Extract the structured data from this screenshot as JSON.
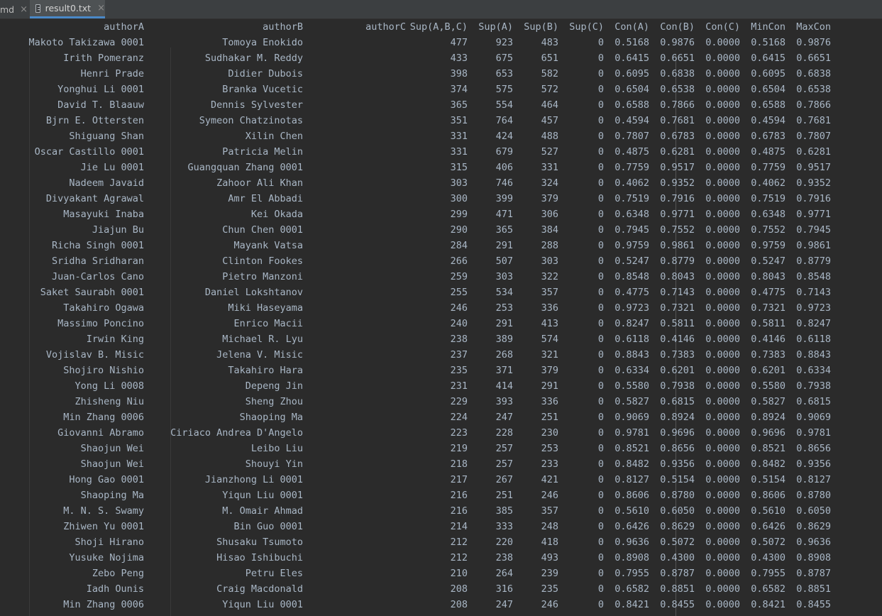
{
  "tabs": {
    "previous": "md",
    "active": "result0.txt",
    "close_glyph": "×"
  },
  "columns": [
    "authorA",
    "authorB",
    "authorC",
    "Sup(A,B,C)",
    "Sup(A)",
    "Sup(B)",
    "Sup(C)",
    "Con(A)",
    "Con(B)",
    "Con(C)",
    "MinCon",
    "MaxCon"
  ],
  "rows": [
    [
      "Makoto Takizawa 0001",
      "Tomoya Enokido",
      "",
      "477",
      "923",
      "483",
      "0",
      "0.5168",
      "0.9876",
      "0.0000",
      "0.5168",
      "0.9876"
    ],
    [
      "Irith Pomeranz",
      "Sudhakar M. Reddy",
      "",
      "433",
      "675",
      "651",
      "0",
      "0.6415",
      "0.6651",
      "0.0000",
      "0.6415",
      "0.6651"
    ],
    [
      "Henri Prade",
      "Didier Dubois",
      "",
      "398",
      "653",
      "582",
      "0",
      "0.6095",
      "0.6838",
      "0.0000",
      "0.6095",
      "0.6838"
    ],
    [
      "Yonghui Li 0001",
      "Branka Vucetic",
      "",
      "374",
      "575",
      "572",
      "0",
      "0.6504",
      "0.6538",
      "0.0000",
      "0.6504",
      "0.6538"
    ],
    [
      "David T. Blaauw",
      "Dennis Sylvester",
      "",
      "365",
      "554",
      "464",
      "0",
      "0.6588",
      "0.7866",
      "0.0000",
      "0.6588",
      "0.7866"
    ],
    [
      "Bjrn E. Ottersten",
      "Symeon Chatzinotas",
      "",
      "351",
      "764",
      "457",
      "0",
      "0.4594",
      "0.7681",
      "0.0000",
      "0.4594",
      "0.7681"
    ],
    [
      "Shiguang Shan",
      "Xilin Chen",
      "",
      "331",
      "424",
      "488",
      "0",
      "0.7807",
      "0.6783",
      "0.0000",
      "0.6783",
      "0.7807"
    ],
    [
      "Oscar Castillo 0001",
      "Patricia Melin",
      "",
      "331",
      "679",
      "527",
      "0",
      "0.4875",
      "0.6281",
      "0.0000",
      "0.4875",
      "0.6281"
    ],
    [
      "Jie Lu 0001",
      "Guangquan Zhang 0001",
      "",
      "315",
      "406",
      "331",
      "0",
      "0.7759",
      "0.9517",
      "0.0000",
      "0.7759",
      "0.9517"
    ],
    [
      "Nadeem Javaid",
      "Zahoor Ali Khan",
      "",
      "303",
      "746",
      "324",
      "0",
      "0.4062",
      "0.9352",
      "0.0000",
      "0.4062",
      "0.9352"
    ],
    [
      "Divyakant Agrawal",
      "Amr El Abbadi",
      "",
      "300",
      "399",
      "379",
      "0",
      "0.7519",
      "0.7916",
      "0.0000",
      "0.7519",
      "0.7916"
    ],
    [
      "Masayuki Inaba",
      "Kei Okada",
      "",
      "299",
      "471",
      "306",
      "0",
      "0.6348",
      "0.9771",
      "0.0000",
      "0.6348",
      "0.9771"
    ],
    [
      "Jiajun Bu",
      "Chun Chen 0001",
      "",
      "290",
      "365",
      "384",
      "0",
      "0.7945",
      "0.7552",
      "0.0000",
      "0.7552",
      "0.7945"
    ],
    [
      "Richa Singh 0001",
      "Mayank Vatsa",
      "",
      "284",
      "291",
      "288",
      "0",
      "0.9759",
      "0.9861",
      "0.0000",
      "0.9759",
      "0.9861"
    ],
    [
      "Sridha Sridharan",
      "Clinton Fookes",
      "",
      "266",
      "507",
      "303",
      "0",
      "0.5247",
      "0.8779",
      "0.0000",
      "0.5247",
      "0.8779"
    ],
    [
      "Juan-Carlos Cano",
      "Pietro Manzoni",
      "",
      "259",
      "303",
      "322",
      "0",
      "0.8548",
      "0.8043",
      "0.0000",
      "0.8043",
      "0.8548"
    ],
    [
      "Saket Saurabh 0001",
      "Daniel Lokshtanov",
      "",
      "255",
      "534",
      "357",
      "0",
      "0.4775",
      "0.7143",
      "0.0000",
      "0.4775",
      "0.7143"
    ],
    [
      "Takahiro Ogawa",
      "Miki Haseyama",
      "",
      "246",
      "253",
      "336",
      "0",
      "0.9723",
      "0.7321",
      "0.0000",
      "0.7321",
      "0.9723"
    ],
    [
      "Massimo Poncino",
      "Enrico Macii",
      "",
      "240",
      "291",
      "413",
      "0",
      "0.8247",
      "0.5811",
      "0.0000",
      "0.5811",
      "0.8247"
    ],
    [
      "Irwin King",
      "Michael R. Lyu",
      "",
      "238",
      "389",
      "574",
      "0",
      "0.6118",
      "0.4146",
      "0.0000",
      "0.4146",
      "0.6118"
    ],
    [
      "Vojislav B. Misic",
      "Jelena V. Misic",
      "",
      "237",
      "268",
      "321",
      "0",
      "0.8843",
      "0.7383",
      "0.0000",
      "0.7383",
      "0.8843"
    ],
    [
      "Shojiro Nishio",
      "Takahiro Hara",
      "",
      "235",
      "371",
      "379",
      "0",
      "0.6334",
      "0.6201",
      "0.0000",
      "0.6201",
      "0.6334"
    ],
    [
      "Yong Li 0008",
      "Depeng Jin",
      "",
      "231",
      "414",
      "291",
      "0",
      "0.5580",
      "0.7938",
      "0.0000",
      "0.5580",
      "0.7938"
    ],
    [
      "Zhisheng Niu",
      "Sheng Zhou",
      "",
      "229",
      "393",
      "336",
      "0",
      "0.5827",
      "0.6815",
      "0.0000",
      "0.5827",
      "0.6815"
    ],
    [
      "Min Zhang 0006",
      "Shaoping Ma",
      "",
      "224",
      "247",
      "251",
      "0",
      "0.9069",
      "0.8924",
      "0.0000",
      "0.8924",
      "0.9069"
    ],
    [
      "Giovanni Abramo",
      "Ciriaco Andrea D'Angelo",
      "",
      "223",
      "228",
      "230",
      "0",
      "0.9781",
      "0.9696",
      "0.0000",
      "0.9696",
      "0.9781"
    ],
    [
      "Shaojun Wei",
      "Leibo Liu",
      "",
      "219",
      "257",
      "253",
      "0",
      "0.8521",
      "0.8656",
      "0.0000",
      "0.8521",
      "0.8656"
    ],
    [
      "Shaojun Wei",
      "Shouyi Yin",
      "",
      "218",
      "257",
      "233",
      "0",
      "0.8482",
      "0.9356",
      "0.0000",
      "0.8482",
      "0.9356"
    ],
    [
      "Hong Gao 0001",
      "Jianzhong Li 0001",
      "",
      "217",
      "267",
      "421",
      "0",
      "0.8127",
      "0.5154",
      "0.0000",
      "0.5154",
      "0.8127"
    ],
    [
      "Shaoping Ma",
      "Yiqun Liu 0001",
      "",
      "216",
      "251",
      "246",
      "0",
      "0.8606",
      "0.8780",
      "0.0000",
      "0.8606",
      "0.8780"
    ],
    [
      "M. N. S. Swamy",
      "M. Omair Ahmad",
      "",
      "216",
      "385",
      "357",
      "0",
      "0.5610",
      "0.6050",
      "0.0000",
      "0.5610",
      "0.6050"
    ],
    [
      "Zhiwen Yu 0001",
      "Bin Guo 0001",
      "",
      "214",
      "333",
      "248",
      "0",
      "0.6426",
      "0.8629",
      "0.0000",
      "0.6426",
      "0.8629"
    ],
    [
      "Shoji Hirano",
      "Shusaku Tsumoto",
      "",
      "212",
      "220",
      "418",
      "0",
      "0.9636",
      "0.5072",
      "0.0000",
      "0.5072",
      "0.9636"
    ],
    [
      "Yusuke Nojima",
      "Hisao Ishibuchi",
      "",
      "212",
      "238",
      "493",
      "0",
      "0.8908",
      "0.4300",
      "0.0000",
      "0.4300",
      "0.8908"
    ],
    [
      "Zebo Peng",
      "Petru Eles",
      "",
      "210",
      "264",
      "239",
      "0",
      "0.7955",
      "0.8787",
      "0.0000",
      "0.7955",
      "0.8787"
    ],
    [
      "Iadh Ounis",
      "Craig Macdonald",
      "",
      "208",
      "316",
      "235",
      "0",
      "0.6582",
      "0.8851",
      "0.0000",
      "0.6582",
      "0.8851"
    ],
    [
      "Min Zhang 0006",
      "Yiqun Liu 0001",
      "",
      "208",
      "247",
      "246",
      "0",
      "0.8421",
      "0.8455",
      "0.0000",
      "0.8421",
      "0.8455"
    ]
  ],
  "colors": {
    "editor_bg": "#2b2b2b",
    "text": "#a9b7c6",
    "tabbar_bg": "#3c3f41",
    "active_tab_underline": "#4a88c7"
  }
}
